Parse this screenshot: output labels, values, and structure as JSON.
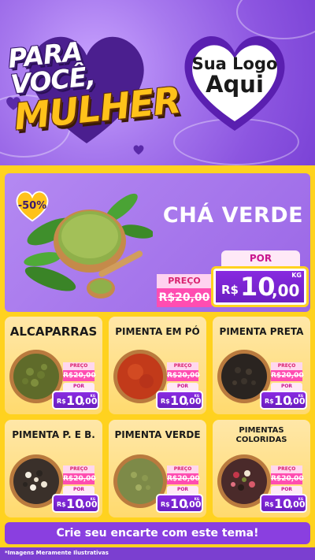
{
  "header": {
    "title_line1": "PARA VOCÊ,",
    "title_line2": "MULHER",
    "logo_line1": "Sua Logo",
    "logo_line2": "Aqui"
  },
  "featured": {
    "discount": "-50%",
    "name": "CHÁ VERDE",
    "price_label": "PREÇO",
    "old_price": "R$20,00",
    "new_label": "POR",
    "new_currency": "R$",
    "new_int": "10",
    "new_dec": ",00",
    "unit": "KG"
  },
  "products": [
    {
      "name": "ALCAPARRAS",
      "price_label": "PREÇO",
      "old_price": "R$20,00",
      "new_label": "POR",
      "currency": "R$",
      "int": "10",
      "dec": ",00",
      "unit": "KG"
    },
    {
      "name": "PIMENTA EM PÓ",
      "price_label": "PREÇO",
      "old_price": "R$20,00",
      "new_label": "POR",
      "currency": "R$",
      "int": "10",
      "dec": ",00",
      "unit": "KG"
    },
    {
      "name": "PIMENTA PRETA",
      "price_label": "PREÇO",
      "old_price": "R$20,00",
      "new_label": "POR",
      "currency": "R$",
      "int": "10",
      "dec": ",00",
      "unit": "KG"
    },
    {
      "name": "PIMENTA P. E B.",
      "price_label": "PREÇO",
      "old_price": "R$20,00",
      "new_label": "POR",
      "currency": "R$",
      "int": "10",
      "dec": ",00",
      "unit": "KG"
    },
    {
      "name": "PIMENTA VERDE",
      "price_label": "PREÇO",
      "old_price": "R$20,00",
      "new_label": "POR",
      "currency": "R$",
      "int": "10",
      "dec": ",00",
      "unit": "KG"
    },
    {
      "name": "PIMENTAS COLORIDAS",
      "price_label": "PREÇO",
      "old_price": "R$20,00",
      "new_label": "POR",
      "currency": "R$",
      "int": "10",
      "dec": ",00",
      "unit": "KG"
    }
  ],
  "cta": "Crie seu encarte com este tema!",
  "footer_note": "*Imagens Meramente Ilustrativas",
  "colors": {
    "background": "#7b3fd0",
    "yellow": "#ffd21f",
    "purple": "#8a2be2",
    "pink": "#ff4db1"
  },
  "icons": [
    "heart-icon",
    "tea-leaf-icon",
    "spice-bowl-icon"
  ]
}
